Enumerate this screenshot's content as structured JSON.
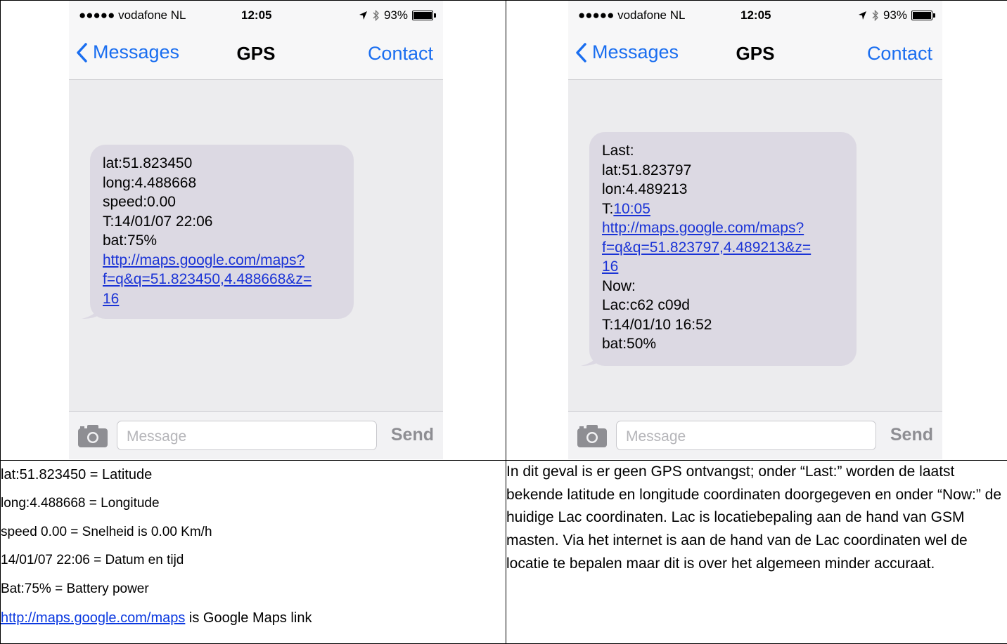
{
  "phones": [
    {
      "status": {
        "carrier": "●●●●● vodafone NL",
        "time": "12:05",
        "battery": "93%",
        "battery_level": 0.93
      },
      "nav": {
        "back": "Messages",
        "title": "GPS",
        "contact": "Contact"
      },
      "message_lines": [
        "lat:51.823450",
        "long:4.488668",
        "speed:0.00",
        "T:14/01/07 22:06",
        "bat:75%"
      ],
      "link_lines": [
        "http://maps.google.com/maps?",
        "f=q&q=51.823450,4.488668&z=",
        "16"
      ],
      "input_placeholder": "Message",
      "send": "Send"
    },
    {
      "status": {
        "carrier": "●●●●● vodafone NL",
        "time": "12:05",
        "battery": "93%",
        "battery_level": 0.93
      },
      "nav": {
        "back": "Messages",
        "title": "GPS",
        "contact": "Contact"
      },
      "pre_lines": [
        "Last:",
        "lat:51.823797",
        "lon:4.489213"
      ],
      "t_prefix": "T:",
      "t_link": "10:05",
      "link_lines": [
        "http://maps.google.com/maps?",
        "f=q&q=51.823797,4.489213&z=",
        "16"
      ],
      "post_lines": [
        "Now:",
        "Lac:c62 c09d",
        "T:14/01/10 16:52",
        "bat:50%"
      ],
      "input_placeholder": "Message",
      "send": "Send"
    }
  ],
  "caption_left": {
    "lines": [
      "lat:51.823450 = Latitude",
      "long:4.488668 = Longitude",
      "speed 0.00 = Snelheid is 0.00 Km/h",
      "14/01/07 22:06 = Datum en tijd",
      "Bat:75% = Battery power"
    ],
    "link": "http://maps.google.com/maps",
    "link_suffix": " is Google Maps link"
  },
  "caption_right": "In dit geval is er geen GPS ontvangst; onder “Last:” worden de laatst bekende latitude en longitude coordinaten doorgegeven en onder “Now:” de huidige Lac coordinaten. Lac is locatiebepaling aan de hand van GSM masten. Via het internet is aan de hand van de Lac coordinaten wel de locatie te bepalen maar dit is over het algemeen minder accuraat."
}
